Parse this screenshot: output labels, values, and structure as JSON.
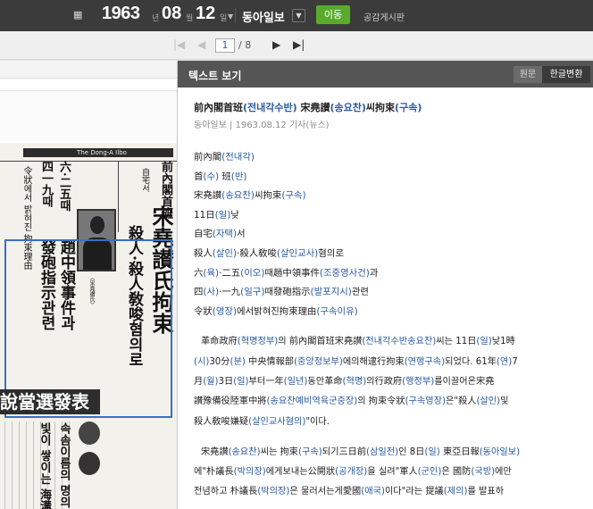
{
  "header": {
    "year": "1963",
    "year_unit": "년",
    "month": "08",
    "month_unit": "월",
    "day": "12",
    "day_unit": "일",
    "newspaper": "동아일보",
    "go_button": "이동",
    "board_link": "공감게시판"
  },
  "pager": {
    "current_page": "1",
    "total_label": "/ 8"
  },
  "scan": {
    "masthead": "The Dong-A Ilbo",
    "headline_top": "前內閣首班",
    "headline_sub": "自宅서",
    "headline_main": "宋堯讃氏拘束",
    "headline_charge": "殺人·殺人敎唆혐의로",
    "col2_title": "六·二五때",
    "col2_line1": "趙中領事件과",
    "col2_line2": "四一九때",
    "col2_line3": "發砲指示관련",
    "col2_line4": "令狀에서 밝혀진 拘束理由",
    "photo_caption": "〈宋堯讃氏〉",
    "banner": "說當選發表",
    "lower_text_1": "속솜이름의 명의",
    "lower_text_2": "빛이 쌓이는 海溝"
  },
  "panel": {
    "title": "텍스트 보기",
    "toggle_original": "원문",
    "toggle_converted": "한글변환",
    "article_title_parts": [
      "前內閣首班",
      "(전내각수반)",
      " 宋堯讃",
      "(송요찬)",
      "씨拘束",
      "(구속)"
    ],
    "meta": "동아일보 | 1963.08.12  기사(뉴스)",
    "lines": [
      [
        "前內閣",
        "(전내각)"
      ],
      [
        "首",
        "(수)",
        " 班",
        "(반)"
      ],
      [
        "宋堯讃",
        "(송요찬)",
        "씨拘束",
        "(구속)"
      ],
      [
        "11日",
        "(일)",
        "낮"
      ],
      [
        "自宅",
        "(자택)",
        "서"
      ],
      [
        "殺人",
        "(살인)",
        "·殺人敎唆",
        "(살인교사)",
        "혐의로"
      ],
      [
        "六",
        "(육)",
        "·二五",
        "(이오)",
        "때趙中領事件",
        "(조중영사건)",
        "과"
      ],
      [
        "四",
        "(사)",
        "·一九",
        "(일구)",
        "때發砲指示",
        "(발포지시)",
        "관련"
      ],
      [
        "令狀",
        "(영장)",
        "에서밝혀진拘束理由",
        "(구속이유)"
      ]
    ],
    "paragraph1": [
      [
        "革命政府",
        "(혁명정부)",
        "의 前內閣首班宋堯讃",
        "(전내각수반송요찬)",
        "씨는 11日",
        "(일)",
        "낮1時"
      ],
      [
        "(시)",
        "30分",
        "(분)",
        " 中央情報部",
        "(중앙정보부)",
        "에의해逮行拘束",
        "(연행구속)",
        "되었다. 61年",
        "(연)",
        "7"
      ],
      [
        "月",
        "(월)",
        "3日",
        "(일)",
        "부터一年",
        "(일년)",
        "동안革命",
        "(혁명)",
        "의行政府",
        "(행정부)",
        "를이끌어온宋堯"
      ],
      [
        "讃豫備役陸軍中將",
        "(송요찬예비역육군중장)",
        "의 拘束令狀",
        "(구속영장)",
        "은\"殺人",
        "(살인)",
        "및"
      ],
      [
        "殺人敎唆嫌疑",
        "(살인교사혐의)",
        "\"이다."
      ]
    ],
    "paragraph2": [
      [
        "宋堯讃",
        "(송요찬)",
        "씨는 拘束",
        "(구속)",
        "되기三日前",
        "(삼일전)",
        "인 8日",
        "(일)",
        " 東亞日報",
        "(동아일보)"
      ],
      [
        "에\"朴議長",
        "(박의장)",
        "에게보내는公開狀",
        "(공개장)",
        "을 실려\"軍人",
        "(군인)",
        "은 國防",
        "(국방)",
        "에만"
      ],
      [
        "전념하고 朴議長",
        "(박의장)",
        "은 물러서는게愛國",
        "(애국)",
        "이다\"라는 提議",
        "(제의)",
        "를 발표하"
      ]
    ]
  }
}
